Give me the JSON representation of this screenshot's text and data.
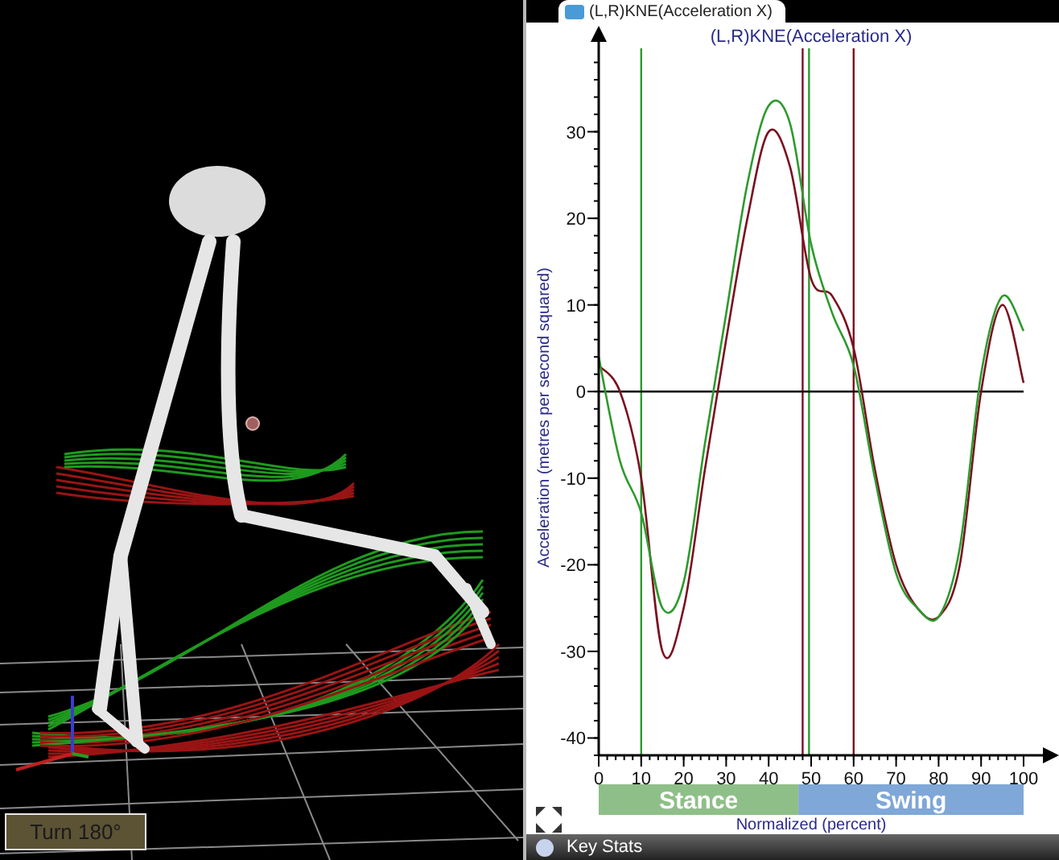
{
  "viewport": {
    "turn_button": "Turn 180°"
  },
  "chart_panel": {
    "tab": {
      "label": "(L,R)KNE(Acceleration X)",
      "selected": true
    },
    "chart_data": {
      "type": "line",
      "title": "(L,R)KNE(Acceleration X)",
      "xlabel": "Normalized (percent)",
      "ylabel": "Acceleration (metres per second squared)",
      "x": [
        0,
        5,
        10,
        15,
        20,
        25,
        30,
        35,
        40,
        45,
        50,
        55,
        60,
        65,
        70,
        75,
        80,
        85,
        90,
        95,
        100
      ],
      "series": [
        {
          "color": "#7a1020",
          "values": [
            3,
            0,
            -10,
            -30,
            -25,
            -9,
            6,
            20,
            30,
            26,
            13,
            11,
            5,
            -9,
            -20,
            -25,
            -26,
            -20,
            0,
            10,
            1
          ]
        },
        {
          "color": "#2e9a2e",
          "values": [
            4,
            -8,
            -14,
            -25,
            -22,
            -6,
            9,
            24,
            33,
            31,
            17,
            9,
            3,
            -10,
            -21,
            -25,
            -26,
            -18,
            2,
            11,
            7
          ]
        }
      ],
      "xlim": [
        0,
        100
      ],
      "ylim": [
        -42,
        40
      ],
      "xticks": [
        0,
        10,
        20,
        30,
        40,
        50,
        60,
        70,
        80,
        90,
        100
      ],
      "yticks": [
        -40,
        -30,
        -20,
        -10,
        0,
        10,
        20,
        30
      ],
      "ref_lines": [
        {
          "axis": "x",
          "value": 10,
          "color": "#2e9a2e"
        },
        {
          "axis": "x",
          "value": 48,
          "color": "#7a1020"
        },
        {
          "axis": "x",
          "value": 49.5,
          "color": "#2e9a2e"
        },
        {
          "axis": "x",
          "value": 60,
          "color": "#7a1020"
        }
      ]
    },
    "phases": [
      {
        "label": "Stance",
        "color": "#8fbf88"
      },
      {
        "label": "Swing",
        "color": "#7fa7d8"
      }
    ],
    "bottom_bar": {
      "label": "Key Stats"
    }
  }
}
